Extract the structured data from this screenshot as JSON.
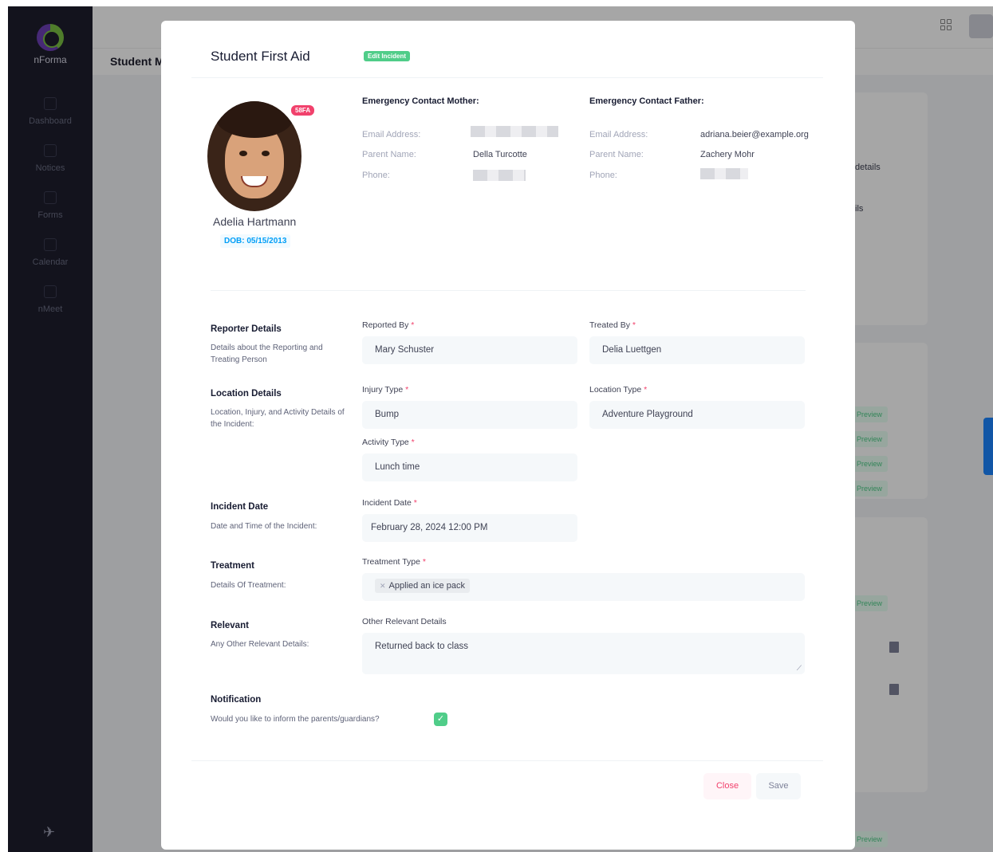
{
  "app": {
    "logo_text": "nForma",
    "nav": [
      {
        "label": "Dashboard"
      },
      {
        "label": "Notices"
      },
      {
        "label": "Forms"
      },
      {
        "label": "Calendar"
      },
      {
        "label": "nMeet"
      }
    ],
    "page_title": "Student M",
    "bg_texts": [
      "details",
      "ils"
    ],
    "preview_label": "Preview"
  },
  "modal": {
    "title": "Student First Aid",
    "edit_badge": "Edit Incident",
    "student": {
      "name": "Adelia Hartmann",
      "dob": "DOB: 05/15/2013",
      "id_badge": "58FA"
    },
    "mother": {
      "title": "Emergency Contact Mother:",
      "email_label": "Email Address:",
      "parent_label": "Parent Name:",
      "parent_name": "Della Turcotte",
      "phone_label": "Phone:"
    },
    "father": {
      "title": "Emergency Contact Father:",
      "email_label": "Email Address:",
      "email": "adriana.beier@example.org",
      "parent_label": "Parent Name:",
      "parent_name": "Zachery Mohr",
      "phone_label": "Phone:"
    },
    "sections": {
      "reporter": {
        "title": "Reporter Details",
        "desc": "Details about the Reporting and Treating Person"
      },
      "location": {
        "title": "Location Details",
        "desc": "Location, Injury, and Activity Details of the Incident:"
      },
      "date": {
        "title": "Incident Date",
        "desc": "Date and Time of the Incident:"
      },
      "treatment": {
        "title": "Treatment",
        "desc": "Details Of Treatment:"
      },
      "relevant": {
        "title": "Relevant",
        "desc": "Any Other Relevant Details:"
      },
      "notification": {
        "title": "Notification",
        "desc": "Would you like to inform the parents/guardians?"
      }
    },
    "fields": {
      "reported_by": {
        "label": "Reported By",
        "value": "Mary Schuster"
      },
      "treated_by": {
        "label": "Treated By",
        "value": "Delia Luettgen"
      },
      "injury_type": {
        "label": "Injury Type",
        "value": "Bump"
      },
      "location_type": {
        "label": "Location Type",
        "value": "Adventure Playground"
      },
      "activity_type": {
        "label": "Activity Type",
        "value": "Lunch time"
      },
      "incident_date": {
        "label": "Incident Date",
        "value": "February 28, 2024 12:00 PM"
      },
      "treatment_type": {
        "label": "Treatment Type",
        "tag": "Applied an ice pack"
      },
      "other_details": {
        "label": "Other Relevant Details",
        "value": "Returned back to class"
      }
    },
    "notify_checked": true,
    "buttons": {
      "close": "Close",
      "save": "Save"
    }
  }
}
